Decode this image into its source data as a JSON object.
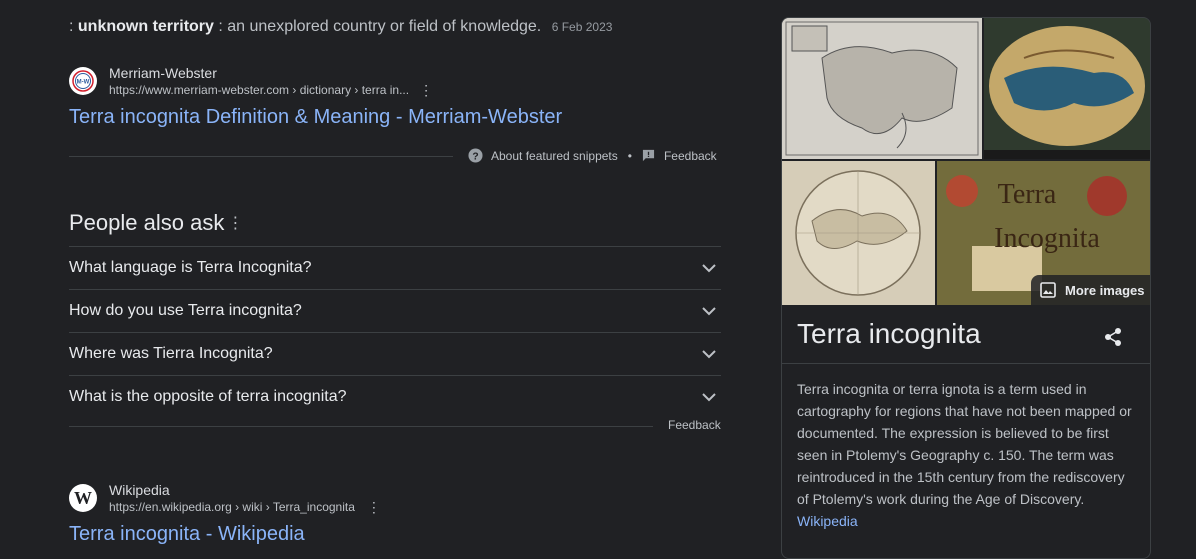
{
  "snippet": {
    "prefix": ":",
    "term": "unknown territory",
    "definition": ": an unexplored country or field of knowledge.",
    "date": "6 Feb 2023"
  },
  "result1": {
    "favicon_text": "M-W",
    "site_name": "Merriam-Webster",
    "url": "https://www.merriam-webster.com › dictionary › terra in...",
    "title": "Terra incognita Definition & Meaning - Merriam-Webster"
  },
  "featured_footer": {
    "about_label": "About featured snippets",
    "separator": "•",
    "feedback_label": "Feedback"
  },
  "people_also_ask": {
    "title": "People also ask",
    "questions": [
      "What language is Terra Incognita?",
      "How do you use Terra incognita?",
      "Where was Tierra Incognita?",
      "What is the opposite of terra incognita?"
    ],
    "feedback_label": "Feedback"
  },
  "result2": {
    "favicon_text": "W",
    "site_name": "Wikipedia",
    "url": "https://en.wikipedia.org › wiki › Terra_incognita",
    "title": "Terra incognita - Wikipedia"
  },
  "knowledge_panel": {
    "more_images_label": "More images",
    "image_text_1": "Terra",
    "image_text_2": "Incognita",
    "title": "Terra incognita",
    "description": "Terra incognita or terra ignota is a term used in cartography for regions that have not been mapped or documented. The expression is believed to be first seen in Ptolemy's Geography c. 150. The term was reintroduced in the 15th century from the rediscovery of Ptolemy's work during the Age of Discovery.",
    "source_link": "Wikipedia"
  },
  "colors": {
    "background": "#202124",
    "link": "#8ab4f8",
    "text": "#bdc1c6",
    "heading": "#e8eaed",
    "divider": "#3c4043"
  }
}
